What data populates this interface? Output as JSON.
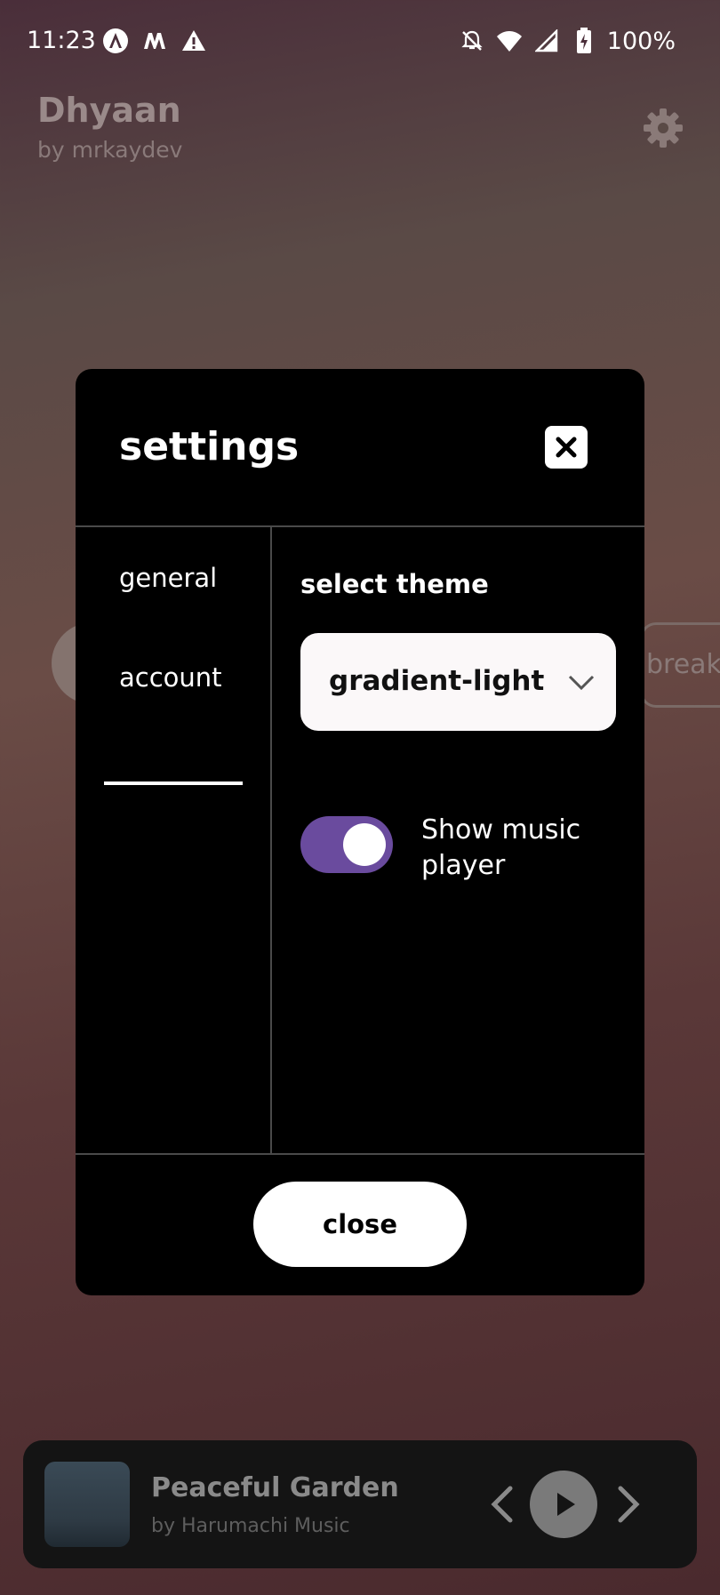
{
  "status_bar": {
    "time": "11:23",
    "battery": "100%",
    "left_icons": [
      "app-a-icon",
      "app-m-icon",
      "warning-icon"
    ],
    "right_icons": [
      "notifications-off-icon",
      "wifi-icon",
      "signal-icon",
      "battery-charging-icon"
    ]
  },
  "app": {
    "title": "Dhyaan",
    "subtitle": "by mrkaydev",
    "settings_icon": "gear-icon",
    "background_button": "break"
  },
  "modal": {
    "title": "settings",
    "close_icon": "close-icon",
    "tabs": [
      {
        "label": "general",
        "active": true
      },
      {
        "label": "account",
        "active": false
      }
    ],
    "select_theme_label": "select theme",
    "theme_value": "gradient-light",
    "toggle_label": "Show music player",
    "toggle_on": true,
    "close_label": "close"
  },
  "player": {
    "track": "Peaceful Garden",
    "artist": "by Harumachi Music"
  },
  "colors": {
    "toggle_on": "#6a4b9e",
    "modal_bg": "#000000"
  }
}
